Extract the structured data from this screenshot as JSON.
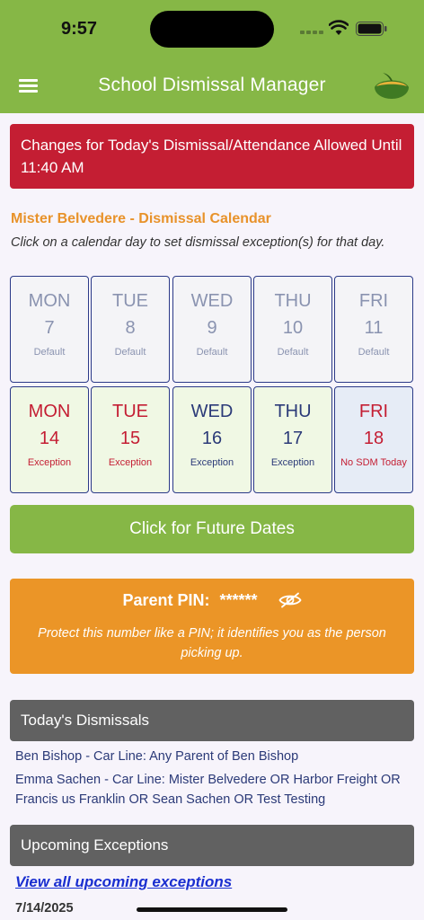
{
  "status_bar": {
    "time": "9:57"
  },
  "app_bar": {
    "title": "School Dismissal Manager"
  },
  "alert": {
    "text": "Changes for Today's Dismissal/Attendance Allowed Until 11:40 AM"
  },
  "calendar": {
    "title": "Mister Belvedere - Dismissal Calendar",
    "subtitle": "Click on a calendar day to set dismissal exception(s) for that day.",
    "week1": [
      {
        "name": "MON",
        "date": "7",
        "status": "Default"
      },
      {
        "name": "TUE",
        "date": "8",
        "status": "Default"
      },
      {
        "name": "WED",
        "date": "9",
        "status": "Default"
      },
      {
        "name": "THU",
        "date": "10",
        "status": "Default"
      },
      {
        "name": "FRI",
        "date": "11",
        "status": "Default"
      }
    ],
    "week2": [
      {
        "name": "MON",
        "date": "14",
        "status": "Exception"
      },
      {
        "name": "TUE",
        "date": "15",
        "status": "Exception"
      },
      {
        "name": "WED",
        "date": "16",
        "status": "Exception"
      },
      {
        "name": "THU",
        "date": "17",
        "status": "Exception"
      },
      {
        "name": "FRI",
        "date": "18",
        "status": "No SDM Today"
      }
    ]
  },
  "future_button": {
    "label": "Click for Future Dates"
  },
  "pin": {
    "label": "Parent PIN:",
    "masked": "******",
    "note": "Protect this number like a PIN; it identifies you as the person picking up."
  },
  "todays_dismissals": {
    "header": "Today's Dismissals",
    "items": [
      "Ben Bishop - Car Line: Any Parent of Ben Bishop",
      "Emma Sachen - Car Line: Mister Belvedere OR Harbor Freight OR Francis us Franklin OR Sean Sachen OR Test Testing"
    ]
  },
  "upcoming_exceptions": {
    "header": "Upcoming Exceptions",
    "link": "View all upcoming exceptions",
    "first_date": "7/14/2025"
  },
  "colors": {
    "brand_green": "#86b746",
    "alert_red": "#c41e33",
    "pin_orange": "#eb9527",
    "section_gray": "#616161",
    "link_blue": "#1a2fd0"
  },
  "icons": [
    "menu-icon",
    "apple-logo-icon",
    "eye-slash-icon",
    "wifi-icon",
    "battery-icon",
    "signal-icon"
  ]
}
